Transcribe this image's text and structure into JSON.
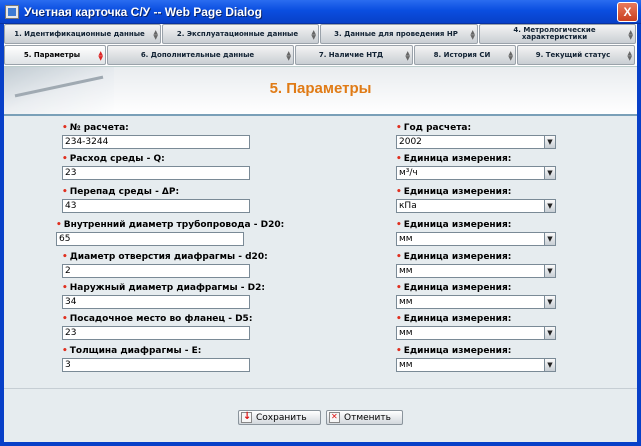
{
  "window": {
    "title": "Учетная карточка С/У -- Web Page Dialog",
    "close_label": "X"
  },
  "tabs_row1": [
    {
      "label": "1. Идентификационные данные"
    },
    {
      "label": "2. Эксплуатационные данные"
    },
    {
      "label": "3. Данные для проведения НР"
    },
    {
      "label": "4. Метрологические характеристики"
    }
  ],
  "tabs_row2": [
    {
      "label": "5. Параметры",
      "active": true
    },
    {
      "label": "6. Дополнительные данные"
    },
    {
      "label": "7. Наличие НТД"
    },
    {
      "label": "8. История СИ"
    },
    {
      "label": "9. Текущий статус"
    }
  ],
  "page": {
    "title": "5. Параметры"
  },
  "left_fields": [
    {
      "label": "№ расчета:",
      "required": true,
      "value": "234-3244"
    },
    {
      "label": "Расход среды - Q:",
      "required": true,
      "value": "23"
    },
    {
      "label": "Перепад среды - ΔP:",
      "required": true,
      "value": "43"
    },
    {
      "label": "Внутренний диаметр трубопровода - D20:",
      "required": true,
      "value": "65"
    },
    {
      "label": "Диаметр отверстия диафрагмы - d20:",
      "required": true,
      "value": "2"
    },
    {
      "label": "Наружный диаметр диафрагмы - D2:",
      "required": true,
      "value": "34"
    },
    {
      "label": "Посадочное место во фланец - D5:",
      "required": true,
      "value": "23"
    },
    {
      "label": "Толщина диафрагмы - E:",
      "required": true,
      "value": "3"
    }
  ],
  "right_fields": [
    {
      "label": "Год расчета:",
      "required": true,
      "value": "2002"
    },
    {
      "label": "Единица измерения:",
      "required": true,
      "value": "м³/ч"
    },
    {
      "label": "Единица измерения:",
      "required": true,
      "value": "кПа"
    },
    {
      "label": "Единица измерения:",
      "required": true,
      "value": "мм"
    },
    {
      "label": "Единица измерения:",
      "required": true,
      "value": "мм"
    },
    {
      "label": "Единица измерения:",
      "required": true,
      "value": "мм"
    },
    {
      "label": "Единица измерения:",
      "required": true,
      "value": "мм"
    },
    {
      "label": "Единица измерения:",
      "required": true,
      "value": "мм"
    }
  ],
  "buttons": {
    "save": "Сохранить",
    "cancel": "Отменить"
  },
  "required_mark": "•",
  "colors": {
    "titlebar": "#0a4ee0",
    "accent_title": "#e07b16",
    "required": "#e03020",
    "content_bg": "#e6ecef"
  }
}
